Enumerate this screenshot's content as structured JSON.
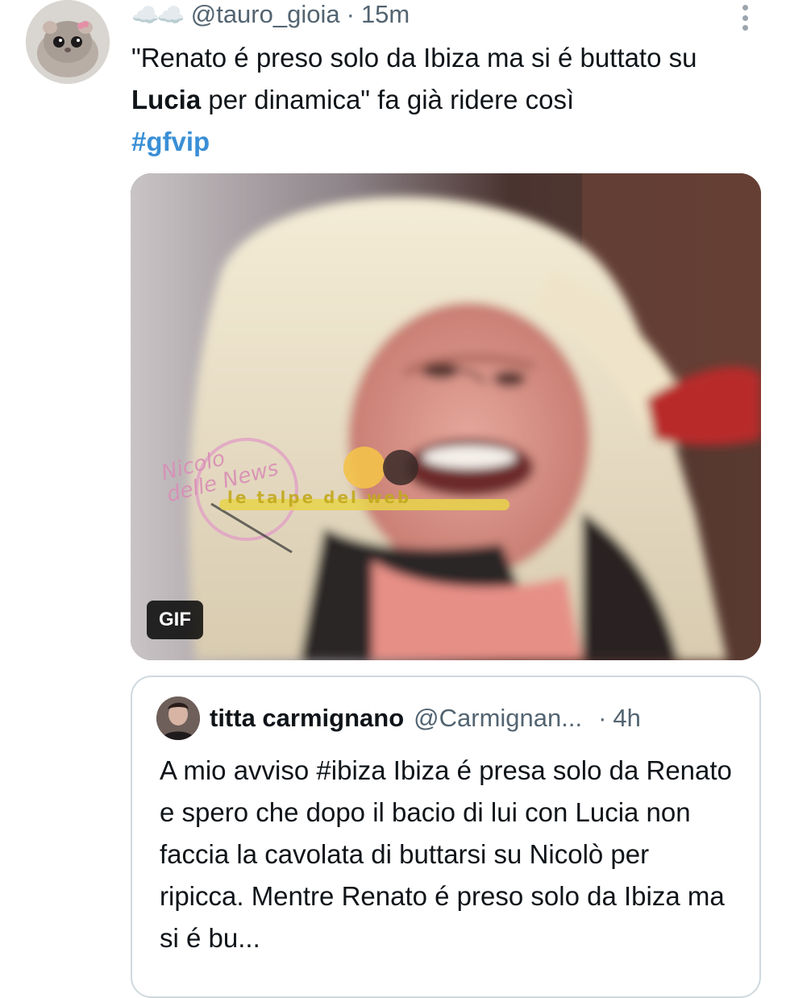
{
  "tweet": {
    "name_emoji": "☁️☁️",
    "handle": "@tauro_gioia",
    "separator": "·",
    "time": "15m",
    "text_part1": "\"Renato é preso solo da Ibiza ma si é buttato su ",
    "text_highlight": "Lucia",
    "text_part2": " per dinamica\" fa già ridere così",
    "hashtag": "#gfvip"
  },
  "media": {
    "badge": "GIF",
    "watermark_left": "Nicolo delle News",
    "watermark_center": "le talpe del web"
  },
  "quoted_tweet": {
    "name": "titta carmignano",
    "handle": "@Carmignan...",
    "separator": "·",
    "time": "4h",
    "text": "A mio avviso #ibiza Ibiza é presa solo da Renato e spero che dopo il bacio di lui con Lucia non faccia la cavolata di buttarsi su Nicolò per ripicca. Mentre Renato é preso solo da Ibiza ma si é bu..."
  },
  "icons": [
    "hamster-avatar",
    "more-options-icon",
    "gif-badge",
    "quoted-avatar"
  ]
}
